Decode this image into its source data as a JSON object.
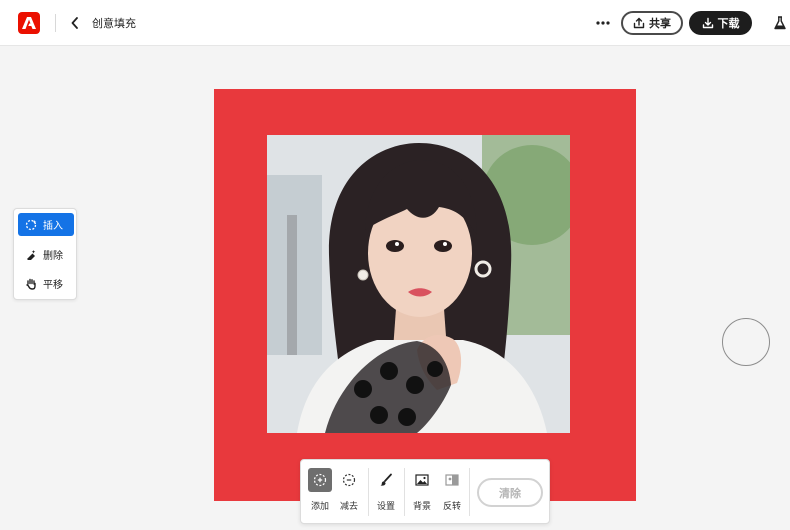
{
  "header": {
    "title": "创意填充",
    "share_label": "共享",
    "download_label": "下载"
  },
  "tools": [
    {
      "label": "插入",
      "icon": "insert-icon",
      "active": true
    },
    {
      "label": "删除",
      "icon": "eraser-icon",
      "active": false
    },
    {
      "label": "平移",
      "icon": "hand-icon",
      "active": false
    }
  ],
  "toolbar": {
    "add_label": "添加",
    "subtract_label": "减去",
    "settings_label": "设置",
    "background_label": "背景",
    "invert_label": "反转",
    "clear_label": "清除"
  },
  "colors": {
    "brand": "#eb1000",
    "canvas_background": "#e8393d",
    "accent": "#1473e6"
  }
}
